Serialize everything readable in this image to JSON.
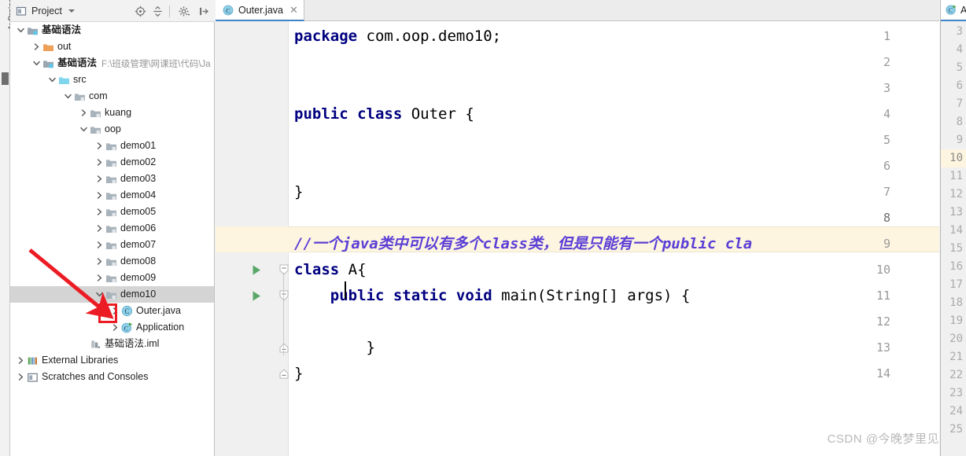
{
  "window": {
    "left_vertical_tab": "1: Project"
  },
  "project_panel": {
    "title": "Project",
    "title_icon": "project-view-icon",
    "toolbar": [
      {
        "name": "locate-in-tree-icon",
        "tooltip": "Select Opened File"
      },
      {
        "name": "collapse-all-icon",
        "tooltip": "Collapse All"
      },
      {
        "name": "settings-gear-icon",
        "tooltip": "Settings"
      },
      {
        "name": "hide-panel-icon",
        "tooltip": "Hide"
      }
    ],
    "tree": [
      {
        "depth": 0,
        "arrow": "down",
        "icon": "module-icon",
        "label": "基础语法",
        "bold": true,
        "path": "",
        "selected": false
      },
      {
        "depth": 1,
        "arrow": "right",
        "icon": "folder-orange-icon",
        "label": "out",
        "bold": false,
        "path": "",
        "selected": false
      },
      {
        "depth": 1,
        "arrow": "down",
        "icon": "module-icon",
        "label": "基础语法",
        "bold": true,
        "path": "F:\\班级管理\\网课班\\代码\\Ja",
        "selected": false
      },
      {
        "depth": 2,
        "arrow": "down",
        "icon": "source-root-icon",
        "label": "src",
        "bold": false,
        "path": "",
        "selected": false
      },
      {
        "depth": 3,
        "arrow": "down",
        "icon": "package-icon",
        "label": "com",
        "bold": false,
        "path": "",
        "selected": false
      },
      {
        "depth": 4,
        "arrow": "right",
        "icon": "package-icon",
        "label": "kuang",
        "bold": false,
        "path": "",
        "selected": false
      },
      {
        "depth": 4,
        "arrow": "down",
        "icon": "package-icon",
        "label": "oop",
        "bold": false,
        "path": "",
        "selected": false
      },
      {
        "depth": 5,
        "arrow": "right",
        "icon": "package-icon",
        "label": "demo01",
        "bold": false,
        "path": "",
        "selected": false
      },
      {
        "depth": 5,
        "arrow": "right",
        "icon": "package-icon",
        "label": "demo02",
        "bold": false,
        "path": "",
        "selected": false
      },
      {
        "depth": 5,
        "arrow": "right",
        "icon": "package-icon",
        "label": "demo03",
        "bold": false,
        "path": "",
        "selected": false
      },
      {
        "depth": 5,
        "arrow": "right",
        "icon": "package-icon",
        "label": "demo04",
        "bold": false,
        "path": "",
        "selected": false
      },
      {
        "depth": 5,
        "arrow": "right",
        "icon": "package-icon",
        "label": "demo05",
        "bold": false,
        "path": "",
        "selected": false
      },
      {
        "depth": 5,
        "arrow": "right",
        "icon": "package-icon",
        "label": "demo06",
        "bold": false,
        "path": "",
        "selected": false
      },
      {
        "depth": 5,
        "arrow": "right",
        "icon": "package-icon",
        "label": "demo07",
        "bold": false,
        "path": "",
        "selected": false
      },
      {
        "depth": 5,
        "arrow": "right",
        "icon": "package-icon",
        "label": "demo08",
        "bold": false,
        "path": "",
        "selected": false
      },
      {
        "depth": 5,
        "arrow": "right",
        "icon": "package-icon",
        "label": "demo09",
        "bold": false,
        "path": "",
        "selected": false
      },
      {
        "depth": 5,
        "arrow": "down",
        "icon": "package-icon",
        "label": "demo10",
        "bold": false,
        "path": "",
        "selected": true
      },
      {
        "depth": 6,
        "arrow": "right",
        "icon": "java-class-icon",
        "label": "Outer.java",
        "bold": false,
        "path": "",
        "selected": false
      },
      {
        "depth": 6,
        "arrow": "right",
        "icon": "java-runnable-class-icon",
        "label": "Application",
        "bold": false,
        "path": "",
        "selected": false
      },
      {
        "depth": 4,
        "arrow": "none",
        "icon": "iml-file-icon",
        "label": "基础语法.iml",
        "bold": false,
        "path": "",
        "selected": false
      },
      {
        "depth": 0,
        "arrow": "right",
        "icon": "external-libraries-icon",
        "label": "External Libraries",
        "bold": false,
        "path": "",
        "selected": false
      },
      {
        "depth": 0,
        "arrow": "right",
        "icon": "scratches-icon",
        "label": "Scratches and Consoles",
        "bold": false,
        "path": "",
        "selected": false
      }
    ]
  },
  "editor": {
    "tabs": [
      {
        "label": "Outer.java",
        "icon": "java-class-icon",
        "active": true,
        "closable": true
      }
    ],
    "current_line": 8,
    "inspection_status": "ok",
    "inspection_status_color": "#4f9c4f",
    "line_count": 14,
    "lines": [
      {
        "n": 1,
        "run_gutter": false,
        "fold": "none",
        "tokens": [
          {
            "t": "package",
            "k": "kw"
          },
          {
            "t": " com.oop.demo10;",
            "k": "plain"
          }
        ]
      },
      {
        "n": 2,
        "run_gutter": false,
        "fold": "none",
        "tokens": []
      },
      {
        "n": 3,
        "run_gutter": false,
        "fold": "none",
        "tokens": []
      },
      {
        "n": 4,
        "run_gutter": false,
        "fold": "none",
        "tokens": [
          {
            "t": "public class",
            "k": "kw"
          },
          {
            "t": " Outer {",
            "k": "plain"
          }
        ]
      },
      {
        "n": 5,
        "run_gutter": false,
        "fold": "none",
        "tokens": []
      },
      {
        "n": 6,
        "run_gutter": false,
        "fold": "none",
        "tokens": []
      },
      {
        "n": 7,
        "run_gutter": false,
        "fold": "none",
        "tokens": [
          {
            "t": "}",
            "k": "plain"
          }
        ]
      },
      {
        "n": 8,
        "run_gutter": false,
        "fold": "none",
        "tokens": []
      },
      {
        "n": 9,
        "run_gutter": false,
        "fold": "none",
        "tokens": [
          {
            "t": "//一个java类中可以有多个class类，但是只能有一个public cla",
            "k": "cmt"
          }
        ]
      },
      {
        "n": 10,
        "run_gutter": true,
        "fold": "open",
        "tokens": [
          {
            "t": "class",
            "k": "kw"
          },
          {
            "t": " A{",
            "k": "plain"
          }
        ]
      },
      {
        "n": 11,
        "run_gutter": true,
        "fold": "open",
        "tokens": [
          {
            "t": "    public static void",
            "k": "kw"
          },
          {
            "t": " main(String[] args) {",
            "k": "plain"
          }
        ]
      },
      {
        "n": 12,
        "run_gutter": false,
        "fold": "none",
        "tokens": []
      },
      {
        "n": 13,
        "run_gutter": false,
        "fold": "close",
        "tokens": [
          {
            "t": "        }",
            "k": "plain"
          }
        ]
      },
      {
        "n": 14,
        "run_gutter": false,
        "fold": "close",
        "tokens": [
          {
            "t": "}",
            "k": "plain"
          }
        ]
      }
    ]
  },
  "split_editor": {
    "tab_label": "A",
    "tab_icon": "java-runnable-class-icon",
    "line_numbers": [
      3,
      4,
      5,
      6,
      7,
      8,
      9,
      10,
      11,
      12,
      13,
      14,
      15,
      16,
      17,
      18,
      19,
      20,
      21,
      22,
      23,
      24,
      25
    ],
    "highlighted_line": 10
  },
  "annotations": {
    "arrow_color": "#ec1c24",
    "box_color": "#ec1c24",
    "arrow_target": "expand-chevron-of-Outer.java",
    "box_target": "expand-chevron-of-Outer.java"
  },
  "watermark": {
    "text": "CSDN @今晚梦里见"
  }
}
